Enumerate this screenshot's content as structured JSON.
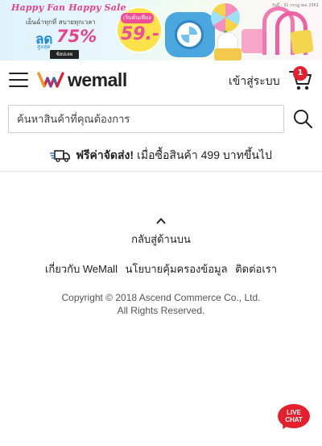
{
  "banner": {
    "title": "Happy Fan Happy Sale",
    "subtitle": "เย็นฉ่ำทุกที่ สบายทุกเวลา",
    "discount_prefix": "ลด",
    "discount_prefix_sub": "สูงสุด",
    "discount_value": "75%",
    "cta": "ช้อปเลย",
    "price_label": "เริ่มต้นเพียง",
    "price_value": "59.-",
    "date_note": "วันนี้ - 31 กรกฎาคม 2561"
  },
  "header": {
    "menu_icon": "hamburger-menu-icon",
    "logo_text": "wemall",
    "login_label": "เข้าสู่ระบบ",
    "cart_icon": "shopping-cart-icon",
    "cart_count": "1",
    "accent": "#e4202e"
  },
  "search": {
    "placeholder": "ค้นหาสินค้าที่คุณต้องการ",
    "value": "",
    "search_icon": "search-icon"
  },
  "shipping": {
    "truck_icon": "delivery-truck-icon",
    "bold_text": "ฟรีค่าจัดส่ง!",
    "rest_text": "เมื่อซื้อสินค้า 499 บาทขึ้นไป"
  },
  "footer": {
    "back_to_top": "กลับสู่ด้านบน",
    "links": [
      "เกี่ยวกับ WeMall",
      "นโยบายคุ้มครองข้อมูล",
      "ติดต่อเรา"
    ],
    "copyright_line1": "Copyright © 2018 Ascend Commerce Co., Ltd.",
    "copyright_line2": "All Rights Reserved."
  },
  "live_chat": {
    "line1": "LIVE",
    "line2": "CHAT"
  }
}
